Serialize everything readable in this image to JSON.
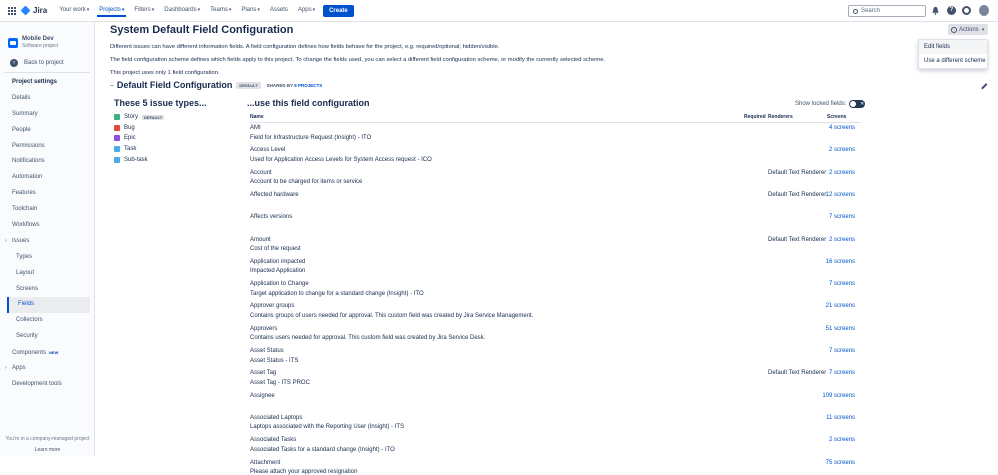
{
  "topnav": {
    "logo_text": "Jira",
    "items": [
      {
        "label": "Your work",
        "active": false
      },
      {
        "label": "Projects",
        "active": true
      },
      {
        "label": "Filters",
        "active": false
      },
      {
        "label": "Dashboards",
        "active": false
      },
      {
        "label": "Teams",
        "active": false
      },
      {
        "label": "Plans",
        "active": false
      },
      {
        "label": "Assets",
        "active": false
      },
      {
        "label": "Apps",
        "active": false
      }
    ],
    "create_label": "Create",
    "search_placeholder": "Search"
  },
  "sidebar": {
    "project_name": "Mobile Dev",
    "project_type": "Software project",
    "back_label": "Back to project",
    "items": [
      {
        "label": "Project settings",
        "kind": "heading"
      },
      {
        "label": "Details",
        "kind": "item"
      },
      {
        "label": "Summary",
        "kind": "item"
      },
      {
        "label": "People",
        "kind": "item"
      },
      {
        "label": "Permissions",
        "kind": "item"
      },
      {
        "label": "Notifications",
        "kind": "item"
      },
      {
        "label": "Automation",
        "kind": "item"
      },
      {
        "label": "Features",
        "kind": "item"
      },
      {
        "label": "Toolchain",
        "kind": "item"
      },
      {
        "label": "Workflows",
        "kind": "item"
      },
      {
        "label": "Issues",
        "kind": "expander"
      },
      {
        "label": "Types",
        "kind": "sub"
      },
      {
        "label": "Layout",
        "kind": "sub"
      },
      {
        "label": "Screens",
        "kind": "sub"
      },
      {
        "label": "Fields",
        "kind": "selected"
      },
      {
        "label": "Collectors",
        "kind": "sub"
      },
      {
        "label": "Security",
        "kind": "sub"
      },
      {
        "label": "Components",
        "kind": "item",
        "badge": "NEW"
      },
      {
        "label": "Apps",
        "kind": "expander"
      },
      {
        "label": "Development tools",
        "kind": "item"
      }
    ],
    "footer_note": "You're in a company-managed project",
    "learn_more": "Learn more"
  },
  "main": {
    "title": "System Default Field Configuration",
    "actions_label": "Actions",
    "actions_menu": [
      "Edit fields",
      "Use a different scheme"
    ],
    "desc1": "Different issues can have different information fields. A field configuration defines how fields behave for the project, e.g. required/optional; hidden/visible.",
    "desc2": "The field configuration scheme defines which fields apply to this project. To change the fields used, you can select a different field configuration scheme, or modify the currently selected scheme.",
    "desc3": "This project uses only 1 field configuration.",
    "config_title": "Default Field Configuration",
    "config_badge": "DEFAULT",
    "shared_prefix": "SHARED BY",
    "shared_link": "8 PROJECTS",
    "left_title": "These 5 issue types...",
    "issue_types": [
      {
        "label": "Story",
        "color": "#36b37e",
        "badge": "DEFAULT"
      },
      {
        "label": "Bug",
        "color": "#e5493a",
        "badge": ""
      },
      {
        "label": "Epic",
        "color": "#904ee2",
        "badge": ""
      },
      {
        "label": "Task",
        "color": "#4bade8",
        "badge": ""
      },
      {
        "label": "Sub-task",
        "color": "#4bade8",
        "badge": ""
      }
    ],
    "right_title": "...use this field configuration",
    "locked_label": "Show locked fields:",
    "columns": {
      "name": "Name",
      "required": "Required",
      "renderers": "Renderers",
      "screens": "Screens"
    },
    "fields": [
      {
        "name": "AMI",
        "desc": "Field for Infrastructure Request (Insight) - ITO",
        "renderer": "",
        "screens": "4 screens"
      },
      {
        "name": "Access Level",
        "desc": "Used for Application Access Levels for System Access request - ICO",
        "renderer": "",
        "screens": "2 screens"
      },
      {
        "name": "Account",
        "desc": "Account to be charged for items or service",
        "renderer": "Default Text Renderer",
        "screens": "2 screens"
      },
      {
        "name": "Affected hardware",
        "desc": "",
        "renderer": "Default Text Renderer",
        "screens": "12 screens"
      },
      {
        "name": "Affects versions",
        "desc": "",
        "renderer": "",
        "screens": "7 screens"
      },
      {
        "name": "Amount",
        "desc": "Cost of the request",
        "renderer": "Default Text Renderer",
        "screens": "2 screens"
      },
      {
        "name": "Application impacted",
        "desc": "Impacted Application",
        "renderer": "",
        "screens": "16 screens"
      },
      {
        "name": "Application to Change",
        "desc": "Target application to change for a standard change (Insight) - ITO",
        "renderer": "",
        "screens": "7 screens"
      },
      {
        "name": "Approver groups",
        "desc": "Contains groups of users needed for approval. This custom field was created by Jira Service Management.",
        "renderer": "",
        "screens": "21 screens"
      },
      {
        "name": "Approvers",
        "desc": "Contains users needed for approval. This custom field was created by Jira Service Desk.",
        "renderer": "",
        "screens": "51 screens"
      },
      {
        "name": "Asset Status",
        "desc": "Asset Status - ITS",
        "renderer": "",
        "screens": "7 screens"
      },
      {
        "name": "Asset Tag",
        "desc": "Asset Tag - ITS PROC",
        "renderer": "Default Text Renderer",
        "screens": "7 screens"
      },
      {
        "name": "Assignee",
        "desc": "",
        "renderer": "",
        "screens": "109 screens"
      },
      {
        "name": "Associated Laptops",
        "desc": "Laptops associated with the Reporting User (Insight) - ITS",
        "renderer": "",
        "screens": "11 screens"
      },
      {
        "name": "Associated Tasks",
        "desc": "Associated Tasks for a standard change (Insight) - ITO",
        "renderer": "",
        "screens": "2 screens"
      },
      {
        "name": "Attachment",
        "desc": "Please attach your approved resignation",
        "renderer": "",
        "screens": "75 screens"
      }
    ]
  }
}
